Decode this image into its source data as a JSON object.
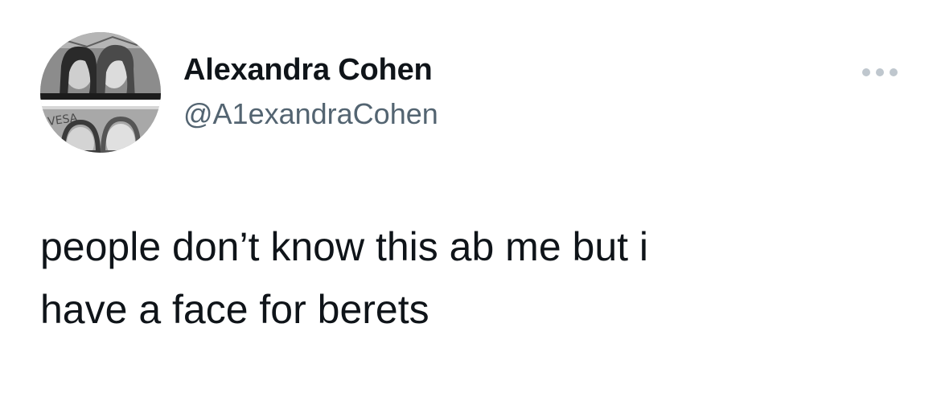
{
  "author": {
    "name": "Alexandra Cohen",
    "handle": "@A1exandraCohen"
  },
  "avatar_icon": "profile-photo",
  "more_icon": "more-options-icon",
  "tweet": {
    "lines": [
      "people don’t know this ab me but i",
      "have a face for berets"
    ]
  },
  "colors": {
    "text": "#0f1419",
    "secondary": "#536471",
    "dots": "#bfc7ce"
  }
}
